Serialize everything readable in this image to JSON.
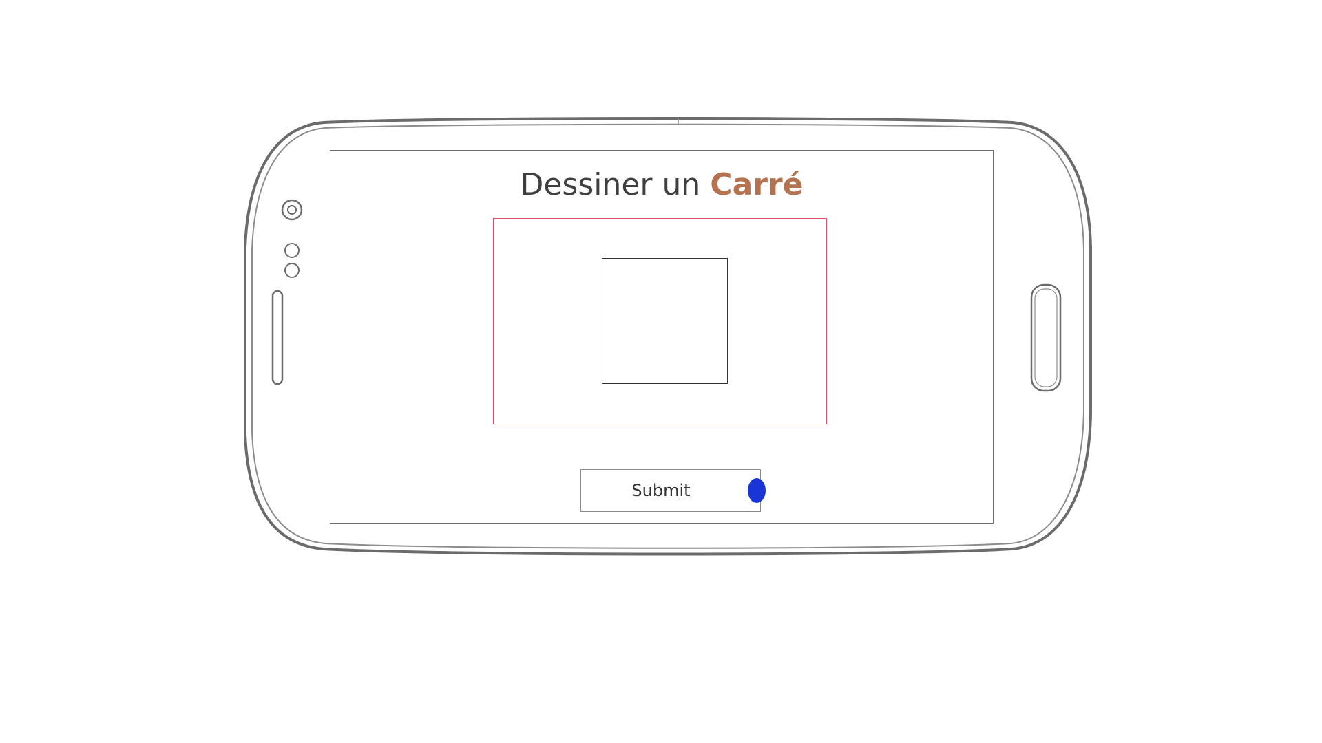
{
  "screen": {
    "title_plain": "Dessiner un",
    "title_accent": "Carré",
    "submit_label": "Submit"
  },
  "colors": {
    "title_text": "#3f3f3f",
    "title_accent": "#b5724f",
    "canvas_border": "#e0506b",
    "submit_indicator": "#1a35d6",
    "phone_outline": "#6b6b6b"
  },
  "icons": {
    "camera": "camera-icon",
    "sensors": "sensor-icon",
    "volume": "volume-button-icon",
    "home": "home-button-icon"
  }
}
